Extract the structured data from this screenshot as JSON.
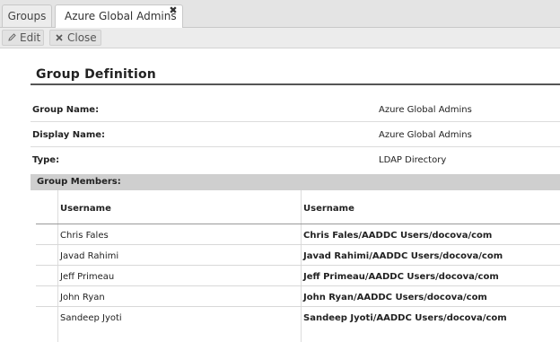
{
  "tabs": [
    {
      "label": "Groups"
    },
    {
      "label": "Azure Global Admins",
      "close_glyph": "✖"
    }
  ],
  "toolbar": {
    "edit_label": "Edit",
    "close_label": "Close"
  },
  "section_title": "Group Definition",
  "fields": [
    {
      "label": "Group Name:",
      "value": "Azure Global Admins"
    },
    {
      "label": "Display Name:",
      "value": "Azure Global Admins"
    },
    {
      "label": "Type:",
      "value": "LDAP Directory"
    }
  ],
  "members": {
    "header": "Group Members:",
    "columns": [
      "Username",
      "Username"
    ],
    "rows": [
      {
        "name": "Chris Fales",
        "path": "Chris Fales/AADDC Users/docova/com"
      },
      {
        "name": "Javad Rahimi",
        "path": "Javad Rahimi/AADDC Users/docova/com"
      },
      {
        "name": "Jeff Primeau",
        "path": "Jeff Primeau/AADDC Users/docova/com"
      },
      {
        "name": "John Ryan",
        "path": "John Ryan/AADDC Users/docova/com"
      },
      {
        "name": "Sandeep Jyoti",
        "path": "Sandeep Jyoti/AADDC Users/docova/com"
      }
    ]
  },
  "icons": {
    "edit": "pencil-icon",
    "close": "x-icon"
  }
}
